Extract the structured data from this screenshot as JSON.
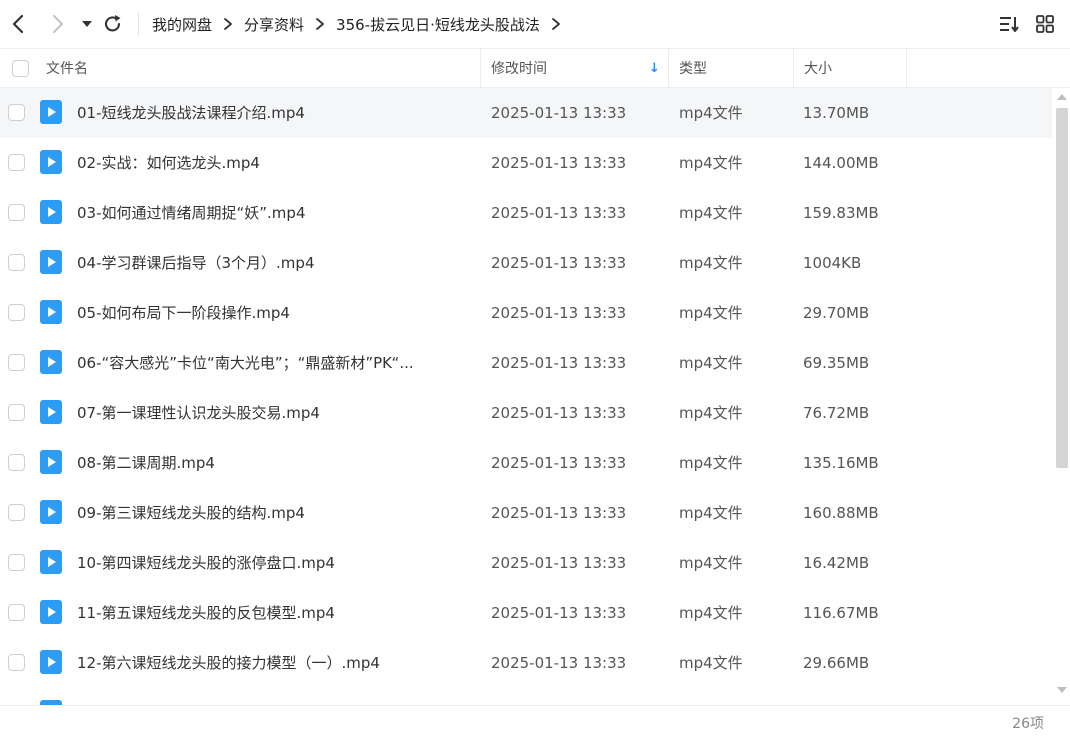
{
  "colors": {
    "accent": "#1a8cff",
    "file_icon": "#2d9cf5",
    "text": "#333333",
    "muted": "#888888"
  },
  "nav": {
    "back_icon": "chevron-left-icon",
    "forward_icon": "chevron-right-icon",
    "dropdown_icon": "caret-down-icon",
    "refresh_icon": "refresh-icon"
  },
  "breadcrumb": [
    "我的网盘",
    "分享资料",
    "356-拔云见日·短线龙头股战法"
  ],
  "view_controls": {
    "sort_icon": "sort-icon",
    "grid_icon": "grid-view-icon"
  },
  "columns": {
    "name": "文件名",
    "modified": "修改时间",
    "type": "类型",
    "size": "大小",
    "sort_indicator": "↓"
  },
  "files": [
    {
      "name": "01-短线龙头股战法课程介绍.mp4",
      "modified": "2025-01-13 13:33",
      "type": "mp4文件",
      "size": "13.70MB"
    },
    {
      "name": "02-实战：如何选龙头.mp4",
      "modified": "2025-01-13 13:33",
      "type": "mp4文件",
      "size": "144.00MB"
    },
    {
      "name": "03-如何通过情绪周期捉“妖”.mp4",
      "modified": "2025-01-13 13:33",
      "type": "mp4文件",
      "size": "159.83MB"
    },
    {
      "name": "04-学习群课后指导（3个月）.mp4",
      "modified": "2025-01-13 13:33",
      "type": "mp4文件",
      "size": "1004KB"
    },
    {
      "name": "05-如何布局下一阶段操作.mp4",
      "modified": "2025-01-13 13:33",
      "type": "mp4文件",
      "size": "29.70MB"
    },
    {
      "name": "06-“容大感光”卡位“南大光电”；“鼎盛新材”PK“...",
      "modified": "2025-01-13 13:33",
      "type": "mp4文件",
      "size": "69.35MB"
    },
    {
      "name": "07-第一课理性认识龙头股交易.mp4",
      "modified": "2025-01-13 13:33",
      "type": "mp4文件",
      "size": "76.72MB"
    },
    {
      "name": "08-第二课周期.mp4",
      "modified": "2025-01-13 13:33",
      "type": "mp4文件",
      "size": "135.16MB"
    },
    {
      "name": "09-第三课短线龙头股的结构.mp4",
      "modified": "2025-01-13 13:33",
      "type": "mp4文件",
      "size": "160.88MB"
    },
    {
      "name": "10-第四课短线龙头股的涨停盘口.mp4",
      "modified": "2025-01-13 13:33",
      "type": "mp4文件",
      "size": "16.42MB"
    },
    {
      "name": "11-第五课短线龙头股的反包模型.mp4",
      "modified": "2025-01-13 13:33",
      "type": "mp4文件",
      "size": "116.67MB"
    },
    {
      "name": "12-第六课短线龙头股的接力模型（一）.mp4",
      "modified": "2025-01-13 13:33",
      "type": "mp4文件",
      "size": "29.66MB"
    }
  ],
  "footer": {
    "item_count": "26项"
  }
}
